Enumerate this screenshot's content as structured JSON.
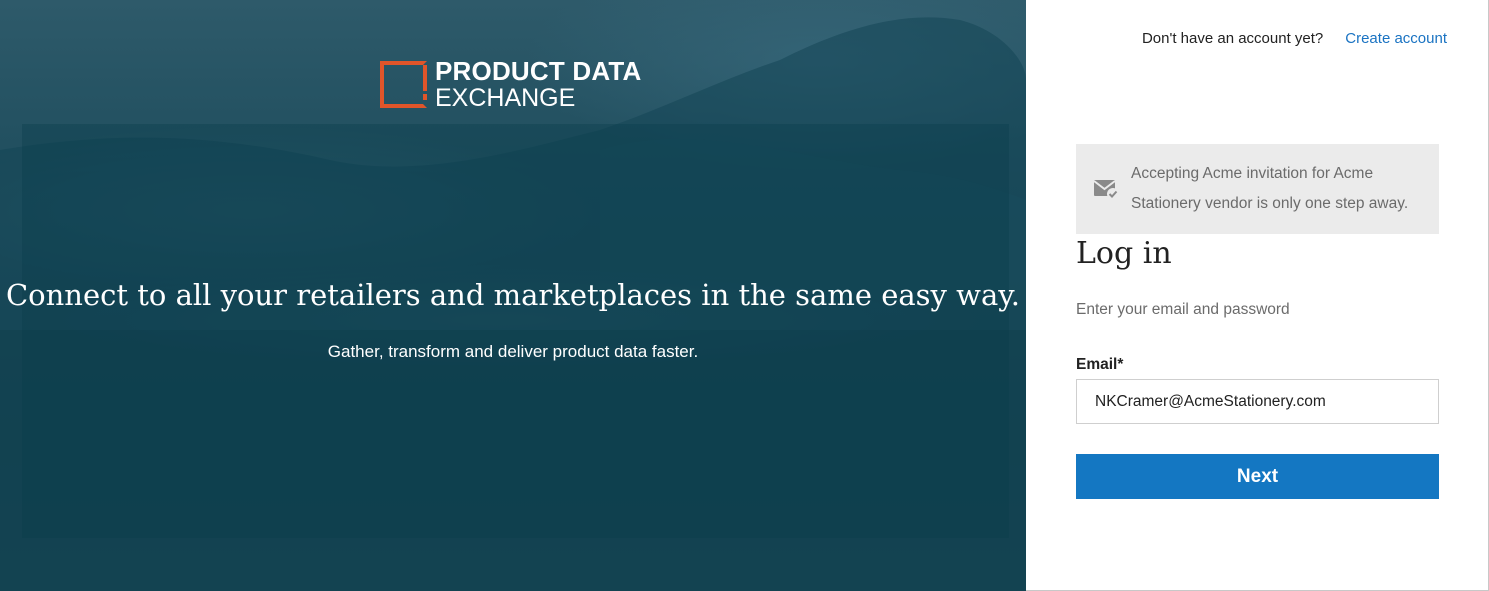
{
  "brand": {
    "line1": "PRODUCT DATA",
    "line2": "EXCHANGE",
    "accent_color": "#e0552a"
  },
  "hero": {
    "headline": "Connect to all your retailers and marketplaces in the same easy way.",
    "subline": "Gather, transform and deliver product data faster."
  },
  "header": {
    "prompt": "Don't have an account yet?",
    "create_account": "Create account"
  },
  "notice": {
    "icon": "mail-check-icon",
    "text": "Accepting Acme invitation for Acme Stationery vendor is only one step away."
  },
  "login": {
    "title": "Log in",
    "subtitle": "Enter your email and password",
    "email_label": "Email*",
    "email_value": "NKCramer@AcmeStationery.com",
    "next_label": "Next"
  },
  "colors": {
    "primary": "#1477c2",
    "link": "#1a73c2",
    "hero_bg": "#1f4e5e"
  }
}
